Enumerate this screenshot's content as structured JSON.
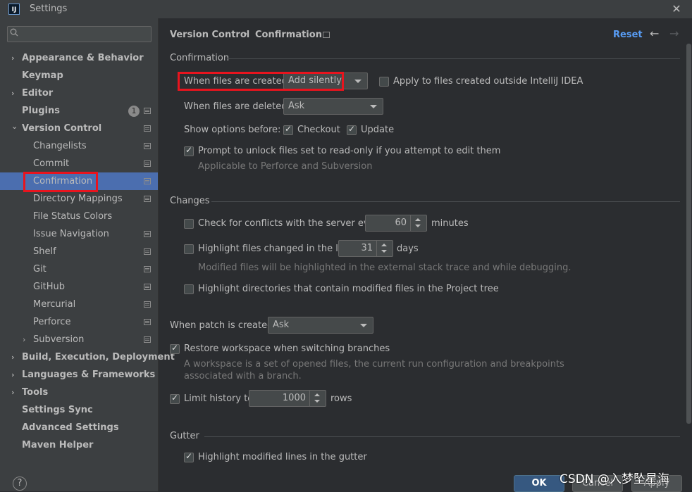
{
  "window": {
    "title": "Settings",
    "logo": "IJ",
    "close": "✕"
  },
  "search": {
    "placeholder": "Q▾"
  },
  "sidebar": {
    "items": [
      {
        "label": "Appearance & Behavior",
        "arrow": "›"
      },
      {
        "label": "Keymap"
      },
      {
        "label": "Editor",
        "arrow": "›"
      },
      {
        "label": "Plugins",
        "badge": "1"
      },
      {
        "label": "Version Control",
        "arrow": "⌄"
      },
      {
        "label": "Changelists"
      },
      {
        "label": "Commit"
      },
      {
        "label": "Confirmation"
      },
      {
        "label": "Directory Mappings"
      },
      {
        "label": "File Status Colors"
      },
      {
        "label": "Issue Navigation"
      },
      {
        "label": "Shelf"
      },
      {
        "label": "Git"
      },
      {
        "label": "GitHub"
      },
      {
        "label": "Mercurial"
      },
      {
        "label": "Perforce"
      },
      {
        "label": "Subversion",
        "arrow": "›"
      },
      {
        "label": "Build, Execution, Deployment",
        "arrow": "›"
      },
      {
        "label": "Languages & Frameworks",
        "arrow": "›"
      },
      {
        "label": "Tools",
        "arrow": "›"
      },
      {
        "label": "Settings Sync"
      },
      {
        "label": "Advanced Settings"
      },
      {
        "label": "Maven Helper"
      }
    ],
    "help": "?"
  },
  "header": {
    "crumb1": "Version Control",
    "sep": "›",
    "crumb2": "Confirmation",
    "reset": "Reset",
    "back": "←",
    "forward": "→"
  },
  "confirmation": {
    "title": "Confirmation",
    "created_label": "When files are created:",
    "created_value": "Add silently",
    "outside_label": "Apply to files created outside IntelliJ IDEA",
    "deleted_label": "When files are deleted:",
    "deleted_value": "Ask",
    "show_options_label": "Show options before:",
    "checkout_label": "Checkout",
    "update_label": "Update",
    "unlock_label": "Prompt to unlock files set to read-only if you attempt to edit them",
    "unlock_hint": "Applicable to Perforce and Subversion"
  },
  "changes": {
    "title": "Changes",
    "conflicts_label": "Check for conflicts with the server every",
    "conflicts_value": "60",
    "conflicts_unit": "minutes",
    "highlight_label": "Highlight files changed in the last",
    "highlight_value": "31",
    "highlight_unit": "days",
    "highlight_hint": "Modified files will be highlighted in the external stack trace and while debugging.",
    "dirs_label": "Highlight directories that contain modified files in the Project tree"
  },
  "patch": {
    "label": "When patch is created:",
    "value": "Ask",
    "restore_label": "Restore workspace when switching branches",
    "restore_hint1": "A workspace is a set of opened files, the current run configuration and breakpoints",
    "restore_hint2": "associated with a branch.",
    "history_label": "Limit history to",
    "history_value": "1000",
    "history_unit": "rows"
  },
  "gutter": {
    "title": "Gutter",
    "highlight_label": "Highlight modified lines in the gutter"
  },
  "buttons": {
    "ok": "OK",
    "cancel": "Cancel",
    "apply": "Apply"
  },
  "watermark": "CSDN @入梦坠星海"
}
